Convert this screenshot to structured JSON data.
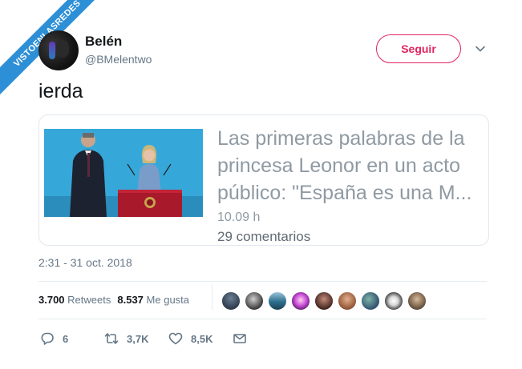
{
  "watermark": "VISTOENLASREDES",
  "author": {
    "display_name": "Belén",
    "handle": "@BMelentwo"
  },
  "follow_label": "Seguir",
  "tweet": {
    "text": "ierda",
    "timestamp": "2:31 - 31 oct. 2018"
  },
  "card": {
    "title": "Las primeras palabras de la princesa Leonor en un acto público: \"España es una M...",
    "time": "10.09 h",
    "comments": "29 comentarios"
  },
  "stats": {
    "retweets_count": "3.700",
    "retweets_label": "Retweets",
    "likes_count": "8.537",
    "likes_label": "Me gusta"
  },
  "likers": [
    "avatar-1",
    "avatar-2",
    "avatar-3",
    "avatar-4",
    "avatar-5",
    "avatar-6",
    "avatar-7",
    "avatar-8",
    "avatar-9"
  ],
  "actions": {
    "reply_count": "6",
    "retweet_count": "3,7K",
    "like_count": "8,5K"
  },
  "colors": {
    "follow_accent": "#e0245e",
    "watermark_bg": "#2d8fd6",
    "muted_text": "#657786"
  },
  "icons": [
    "chevron-down-icon",
    "reply-icon",
    "retweet-icon",
    "like-icon",
    "message-icon"
  ]
}
